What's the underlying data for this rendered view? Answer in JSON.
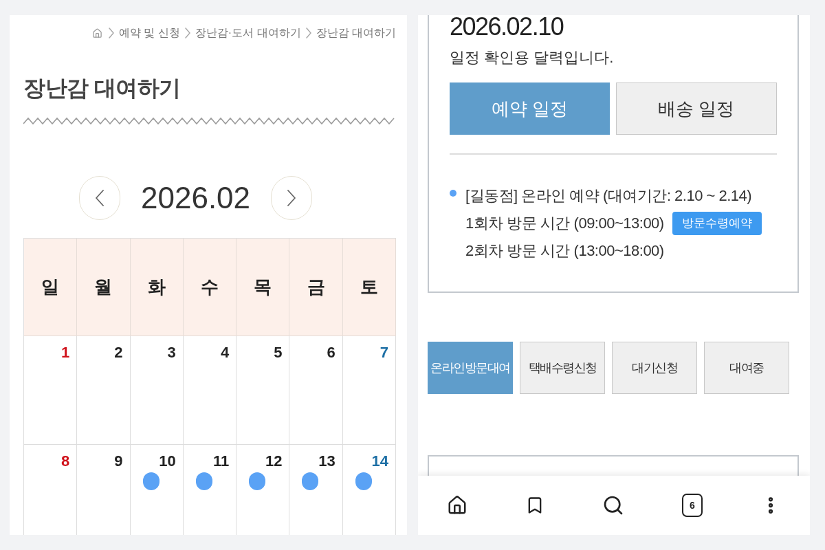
{
  "left_screen": {
    "breadcrumb": [
      {
        "label": "예약 및 신청"
      },
      {
        "label": "장난감·도서 대여하기"
      },
      {
        "label": "장난감 대여하기"
      }
    ],
    "title": "장난감 대여하기",
    "calendar": {
      "month": "2026.02",
      "weekdays": [
        "일",
        "월",
        "화",
        "수",
        "목",
        "금",
        "토"
      ],
      "weeks": [
        {
          "days": [
            {
              "day": "1",
              "kind": "sunday",
              "marked": false
            },
            {
              "day": "2",
              "kind": "weekday",
              "marked": false
            },
            {
              "day": "3",
              "kind": "weekday",
              "marked": false
            },
            {
              "day": "4",
              "kind": "weekday",
              "marked": false
            },
            {
              "day": "5",
              "kind": "weekday",
              "marked": false
            },
            {
              "day": "6",
              "kind": "weekday",
              "marked": false
            },
            {
              "day": "7",
              "kind": "saturday",
              "marked": false
            }
          ]
        },
        {
          "days": [
            {
              "day": "8",
              "kind": "sunday",
              "marked": false
            },
            {
              "day": "9",
              "kind": "weekday",
              "marked": false
            },
            {
              "day": "10",
              "kind": "weekday",
              "marked": true
            },
            {
              "day": "11",
              "kind": "weekday",
              "marked": true
            },
            {
              "day": "12",
              "kind": "weekday",
              "marked": true
            },
            {
              "day": "13",
              "kind": "weekday",
              "marked": true
            },
            {
              "day": "14",
              "kind": "saturday",
              "marked": true
            }
          ]
        }
      ]
    }
  },
  "right_screen": {
    "date": "2026.02.10",
    "caption": "일정 확인용 달력입니다.",
    "schedule_tabs": [
      {
        "label": "예약 일정",
        "selected": true
      },
      {
        "label": "배송 일정",
        "selected": false
      }
    ],
    "events": [
      {
        "title": "[길동점] 온라인 예약 (대여기간: 2.10 ~ 2.14)",
        "slots": [
          {
            "label": "1회차 방문 시간 (09:00~13:00)",
            "badge": "방문수령예약"
          },
          {
            "label": "2회차 방문 시간 (13:00~18:00)"
          }
        ]
      }
    ],
    "rental_tabs": [
      {
        "label": "온라인방문대여",
        "selected": true
      },
      {
        "label": "택배수령신청",
        "selected": false
      },
      {
        "label": "대기신청",
        "selected": false
      },
      {
        "label": "대여중",
        "selected": false
      }
    ],
    "browser_bar": {
      "tab_count": "6"
    }
  }
}
